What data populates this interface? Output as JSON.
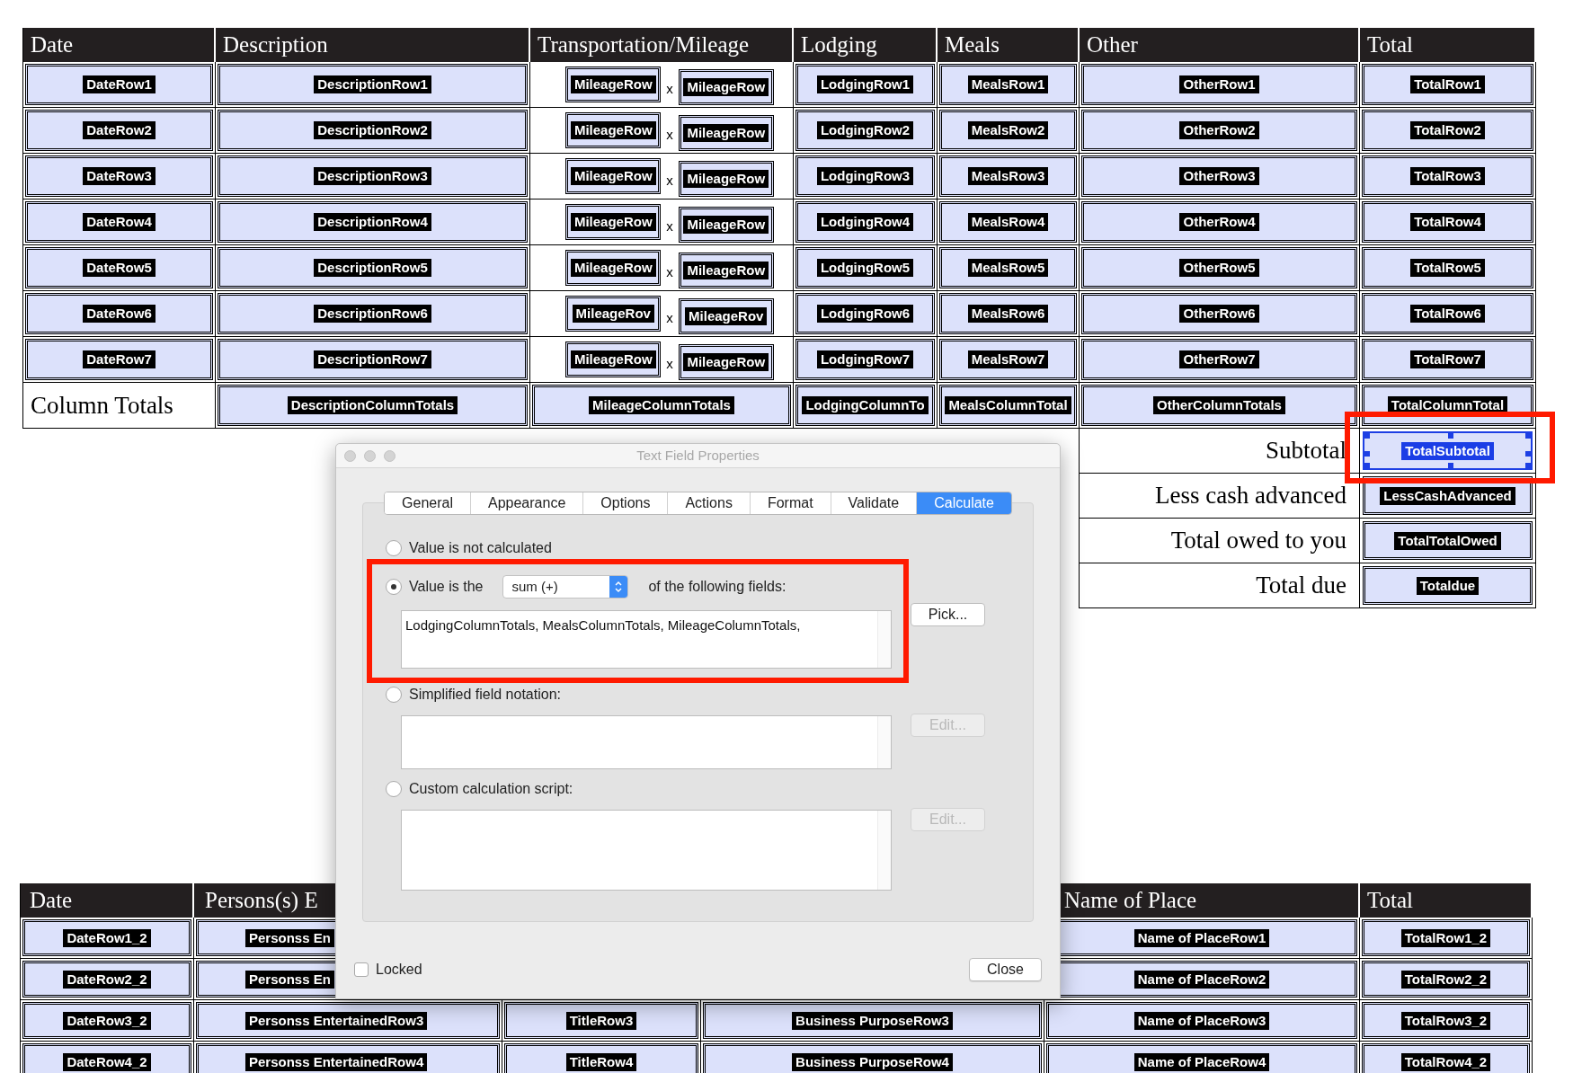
{
  "expense_table": {
    "columns": [
      "Date",
      "Description",
      "Transportation/Mileage",
      "Lodging",
      "Meals",
      "Other",
      "Total"
    ],
    "rows": [
      {
        "cells": [
          {
            "kind": "field",
            "value": "DateRow1"
          },
          {
            "kind": "field",
            "value": "DescriptionRow1"
          },
          {
            "kind": "mileage",
            "values": [
              "MileageRow",
              "MileageRow"
            ],
            "separator": "x"
          },
          {
            "kind": "field",
            "value": "LodgingRow1"
          },
          {
            "kind": "field",
            "value": "MealsRow1"
          },
          {
            "kind": "field",
            "value": "OtherRow1"
          },
          {
            "kind": "field",
            "value": "TotalRow1"
          }
        ]
      },
      {
        "cells": [
          {
            "kind": "field",
            "value": "DateRow2"
          },
          {
            "kind": "field",
            "value": "DescriptionRow2"
          },
          {
            "kind": "mileage",
            "values": [
              "MileageRow",
              "MileageRow"
            ],
            "separator": "x"
          },
          {
            "kind": "field",
            "value": "LodgingRow2"
          },
          {
            "kind": "field",
            "value": "MealsRow2"
          },
          {
            "kind": "field",
            "value": "OtherRow2"
          },
          {
            "kind": "field",
            "value": "TotalRow2"
          }
        ]
      },
      {
        "cells": [
          {
            "kind": "field",
            "value": "DateRow3"
          },
          {
            "kind": "field",
            "value": "DescriptionRow3"
          },
          {
            "kind": "mileage",
            "values": [
              "MileageRow",
              "MileageRow"
            ],
            "separator": "x"
          },
          {
            "kind": "field",
            "value": "LodgingRow3"
          },
          {
            "kind": "field",
            "value": "MealsRow3"
          },
          {
            "kind": "field",
            "value": "OtherRow3"
          },
          {
            "kind": "field",
            "value": "TotalRow3"
          }
        ]
      },
      {
        "cells": [
          {
            "kind": "field",
            "value": "DateRow4"
          },
          {
            "kind": "field",
            "value": "DescriptionRow4"
          },
          {
            "kind": "mileage",
            "values": [
              "MileageRow",
              "MileageRow"
            ],
            "separator": "x"
          },
          {
            "kind": "field",
            "value": "LodgingRow4"
          },
          {
            "kind": "field",
            "value": "MealsRow4"
          },
          {
            "kind": "field",
            "value": "OtherRow4"
          },
          {
            "kind": "field",
            "value": "TotalRow4"
          }
        ]
      },
      {
        "cells": [
          {
            "kind": "field",
            "value": "DateRow5"
          },
          {
            "kind": "field",
            "value": "DescriptionRow5"
          },
          {
            "kind": "mileage",
            "values": [
              "MileageRow",
              "MileageRow"
            ],
            "separator": "x"
          },
          {
            "kind": "field",
            "value": "LodgingRow5"
          },
          {
            "kind": "field",
            "value": "MealsRow5"
          },
          {
            "kind": "field",
            "value": "OtherRow5"
          },
          {
            "kind": "field",
            "value": "TotalRow5"
          }
        ]
      },
      {
        "cells": [
          {
            "kind": "field",
            "value": "DateRow6"
          },
          {
            "kind": "field",
            "value": "DescriptionRow6"
          },
          {
            "kind": "mileage",
            "values": [
              "MileageRov",
              "MileageRov"
            ],
            "separator": "x"
          },
          {
            "kind": "field",
            "value": "LodgingRow6"
          },
          {
            "kind": "field",
            "value": "MealsRow6"
          },
          {
            "kind": "field",
            "value": "OtherRow6"
          },
          {
            "kind": "field",
            "value": "TotalRow6"
          }
        ]
      },
      {
        "cells": [
          {
            "kind": "field",
            "value": "DateRow7"
          },
          {
            "kind": "field",
            "value": "DescriptionRow7"
          },
          {
            "kind": "mileage",
            "values": [
              "MileageRow",
              "MileageRow"
            ],
            "separator": "x"
          },
          {
            "kind": "field",
            "value": "LodgingRow7"
          },
          {
            "kind": "field",
            "value": "MealsRow7"
          },
          {
            "kind": "field",
            "value": "OtherRow7"
          },
          {
            "kind": "field",
            "value": "TotalRow7"
          }
        ]
      },
      {
        "cells": [
          {
            "kind": "text",
            "value": "Column Totals"
          },
          {
            "kind": "field",
            "value": "DescriptionColumnTotals"
          },
          {
            "kind": "field",
            "value": "MileageColumnTotals"
          },
          {
            "kind": "field",
            "value": "LodgingColumnTo"
          },
          {
            "kind": "field",
            "value": "MealsColumnTotal"
          },
          {
            "kind": "field",
            "value": "OtherColumnTotals"
          },
          {
            "kind": "field",
            "value": "TotalColumnTotal"
          }
        ]
      }
    ]
  },
  "summary_rows": [
    {
      "label": "Subtotal",
      "field": "TotalSubtotal",
      "selected": true
    },
    {
      "label": "Less cash advanced",
      "field": "LessCashAdvanced",
      "selected": false
    },
    {
      "label": "Total owed to you",
      "field": "TotalTotalOwed",
      "selected": false
    },
    {
      "label": "Total due",
      "field": "Totaldue",
      "selected": false
    }
  ],
  "dialog": {
    "title": "Text Field Properties",
    "tabs": [
      {
        "label": "General",
        "selected": false
      },
      {
        "label": "Appearance",
        "selected": false
      },
      {
        "label": "Options",
        "selected": false
      },
      {
        "label": "Actions",
        "selected": false
      },
      {
        "label": "Format",
        "selected": false
      },
      {
        "label": "Validate",
        "selected": false
      },
      {
        "label": "Calculate",
        "selected": true
      }
    ],
    "options": [
      {
        "kind": "plain",
        "label": "Value is not calculated",
        "selected": false
      },
      {
        "kind": "function",
        "label": "Value is the",
        "function": "sum (+)",
        "suffix": "of the following fields:",
        "fields": "LodgingColumnTotals, MealsColumnTotals, MileageColumnTotals,",
        "button": "Pick...",
        "button_disabled": false,
        "selected": true
      },
      {
        "kind": "editor",
        "label": "Simplified field notation:",
        "button": "Edit...",
        "button_disabled": true,
        "selected": false
      },
      {
        "kind": "script",
        "label": "Custom calculation script:",
        "button": "Edit...",
        "button_disabled": true,
        "selected": false
      }
    ],
    "locked": {
      "label": "Locked",
      "checked": false
    },
    "close": "Close"
  },
  "entertainment_table": {
    "columns": [
      "Date",
      "Persons(s) E",
      null,
      null,
      "Name of Place",
      "Total"
    ],
    "rows": [
      {
        "cells": [
          "DateRow1_2",
          "Personss En",
          null,
          null,
          "Name of PlaceRow1",
          "TotalRow1_2"
        ]
      },
      {
        "cells": [
          "DateRow2_2",
          "Personss En",
          null,
          null,
          "Name of PlaceRow2",
          "TotalRow2_2"
        ]
      },
      {
        "cells": [
          "DateRow3_2",
          "Personss EntertainedRow3",
          "TitleRow3",
          "Business PurposeRow3",
          "Name of PlaceRow3",
          "TotalRow3_2"
        ]
      },
      {
        "cells": [
          "DateRow4_2",
          "Personss EntertainedRow4",
          "TitleRow4",
          "Business PurposeRow4",
          "Name of PlaceRow4",
          "TotalRow4_2"
        ]
      }
    ]
  }
}
